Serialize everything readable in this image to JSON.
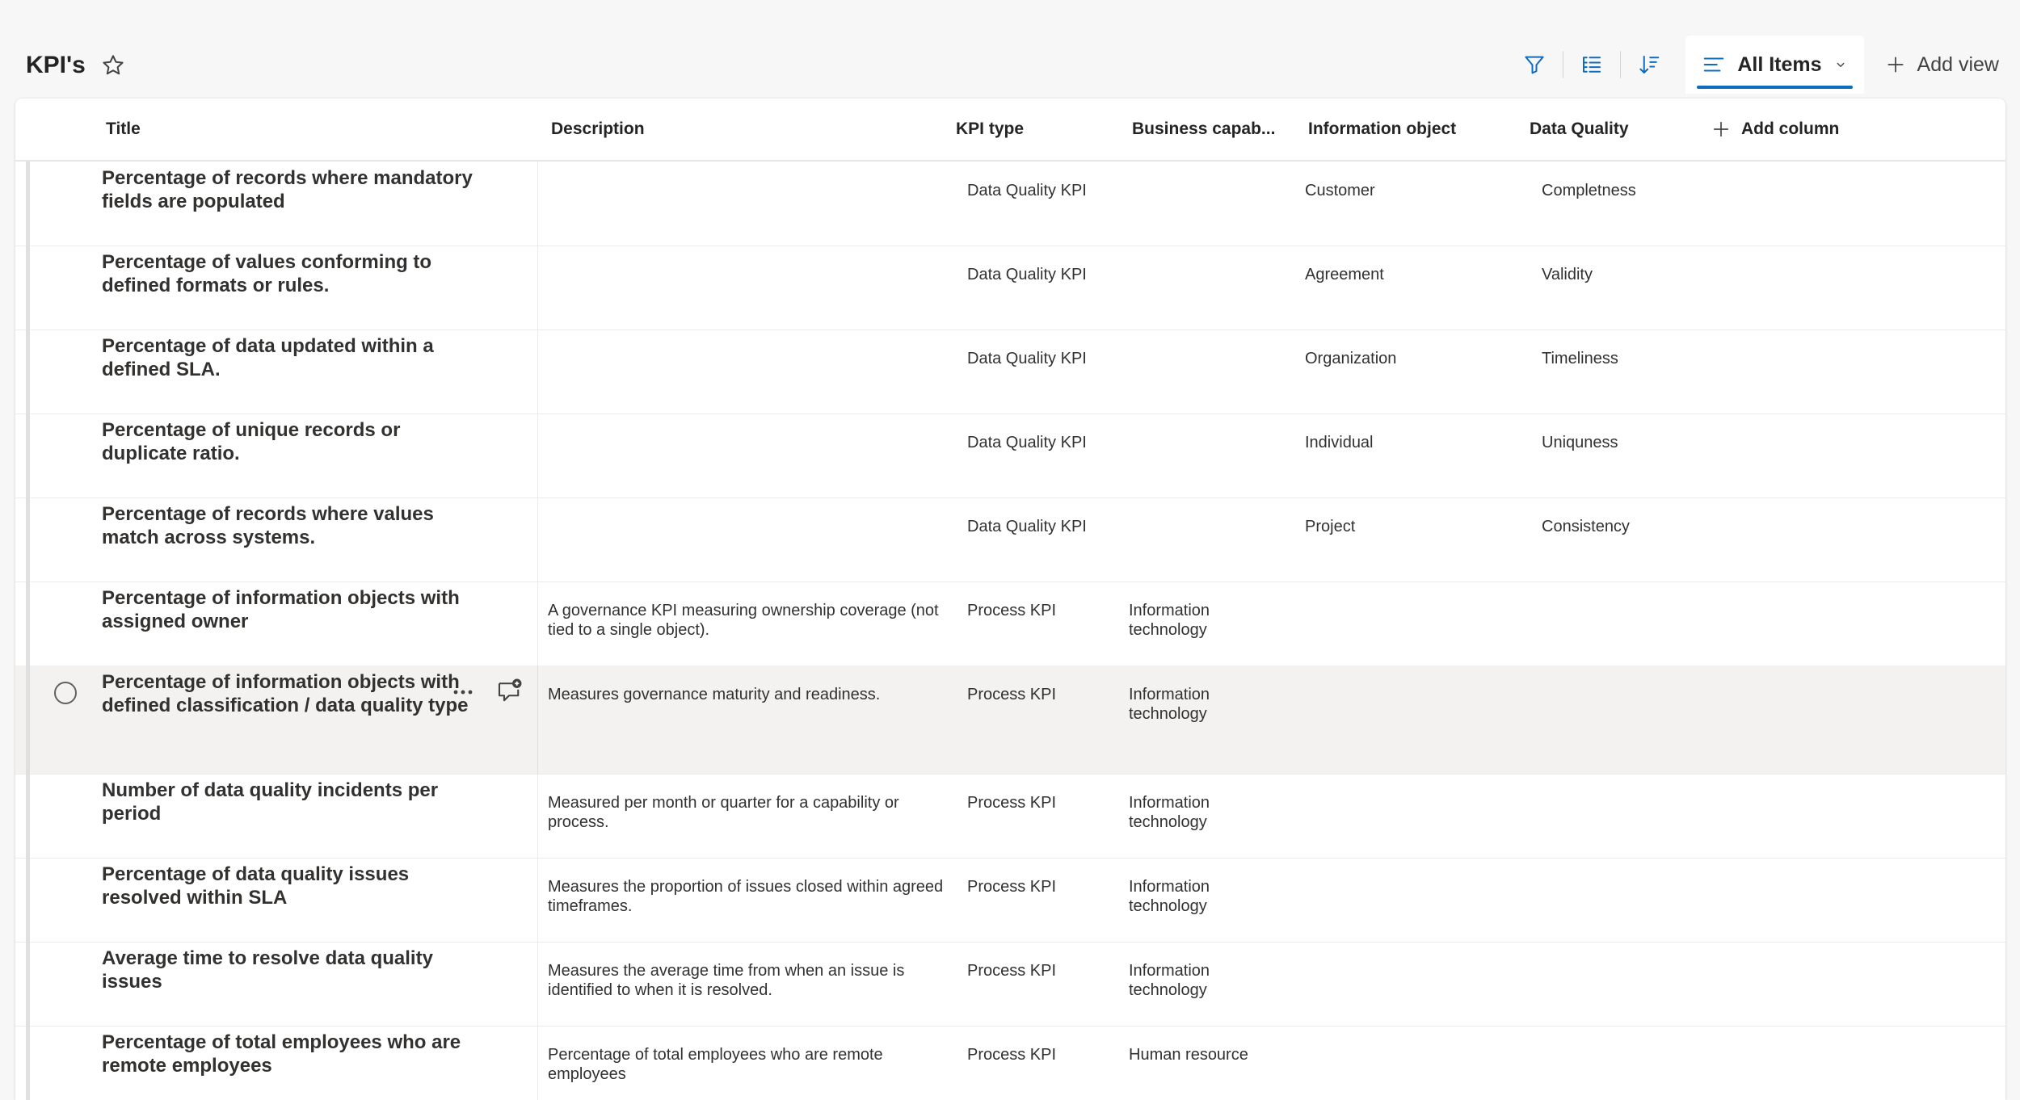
{
  "list": {
    "title": "KPI's"
  },
  "cmdbar": {
    "view_label": "All Items",
    "add_view_label": "Add view"
  },
  "columns": {
    "title": "Title",
    "description": "Description",
    "kpi_type": "KPI type",
    "business_capability": "Business capab...",
    "information_object": "Information object",
    "data_quality": "Data Quality",
    "add_column": "Add column"
  },
  "rows": [
    {
      "title": "Percentage of records where mandatory fields are populated",
      "description": "",
      "kpi_type": "Data Quality KPI",
      "business_capability": "",
      "information_object": "Customer",
      "data_quality": "Completness"
    },
    {
      "title": "Percentage of values conforming to defined formats or rules.",
      "description": "",
      "kpi_type": "Data Quality KPI",
      "business_capability": "",
      "information_object": "Agreement",
      "data_quality": "Validity"
    },
    {
      "title": "Percentage of data updated within a defined SLA.",
      "description": "",
      "kpi_type": "Data Quality KPI",
      "business_capability": "",
      "information_object": "Organization",
      "data_quality": "Timeliness"
    },
    {
      "title": "Percentage of unique records or duplicate ratio.",
      "description": "",
      "kpi_type": "Data Quality KPI",
      "business_capability": "",
      "information_object": "Individual",
      "data_quality": "Uniquness"
    },
    {
      "title": "Percentage of records where values match across systems.",
      "description": "",
      "kpi_type": "Data Quality KPI",
      "business_capability": "",
      "information_object": "Project",
      "data_quality": "Consistency"
    },
    {
      "title": "Percentage of information objects with assigned owner",
      "description": "A governance KPI measuring ownership coverage (not tied to a single object).",
      "kpi_type": "Process KPI",
      "business_capability": "Information technology",
      "information_object": "",
      "data_quality": ""
    },
    {
      "title": "Percentage of information objects with defined classification / data quality type",
      "description": "Measures governance maturity and readiness.",
      "kpi_type": "Process KPI",
      "business_capability": "Information technology",
      "information_object": "",
      "data_quality": ""
    },
    {
      "title": "Number of data quality incidents per period",
      "description": "Measured per month or quarter for a capability or process.",
      "kpi_type": "Process KPI",
      "business_capability": "Information technology",
      "information_object": "",
      "data_quality": ""
    },
    {
      "title": "Percentage of data quality issues resolved within SLA",
      "description": "Measures the proportion of issues closed within agreed timeframes.",
      "kpi_type": "Process KPI",
      "business_capability": "Information technology",
      "information_object": "",
      "data_quality": ""
    },
    {
      "title": "Average time to resolve data quality issues",
      "description": "Measures the average time from when an issue is identified to when it is resolved.",
      "kpi_type": "Process KPI",
      "business_capability": "Information technology",
      "information_object": "",
      "data_quality": ""
    },
    {
      "title": "Percentage of total employees who are remote employees",
      "description": "Percentage of total employees who are remote employees",
      "kpi_type": "Process KPI",
      "business_capability": "Human resource",
      "information_object": "",
      "data_quality": ""
    }
  ],
  "colors": {
    "accent": "#0f6cbd",
    "hover_row": "#f3f2f1"
  }
}
